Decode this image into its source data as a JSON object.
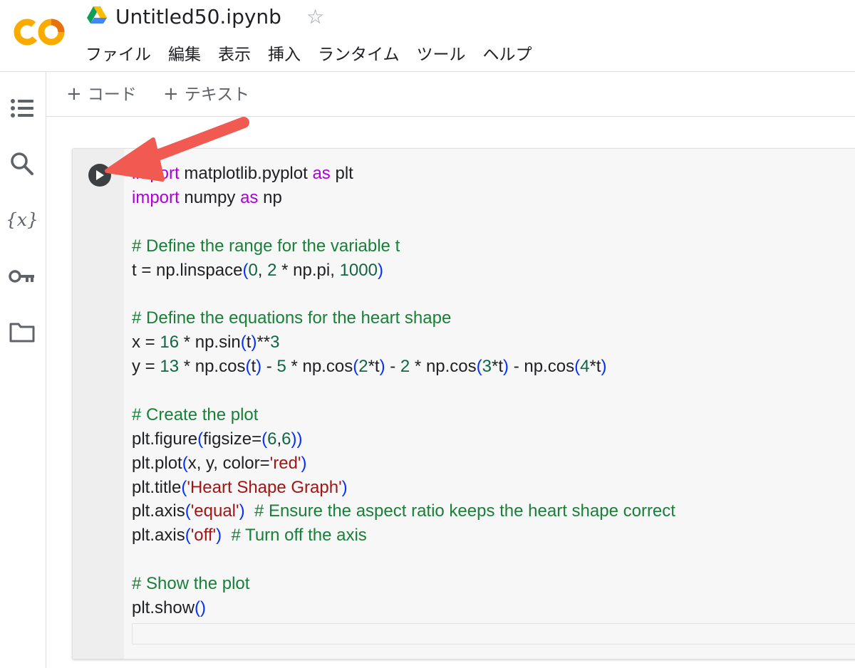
{
  "app": {
    "notebook_title": "Untitled50.ipynb",
    "menu": [
      "ファイル",
      "編集",
      "表示",
      "挿入",
      "ランタイム",
      "ツール",
      "ヘルプ"
    ]
  },
  "sidebar": {
    "icons": [
      "table-of-contents-icon",
      "search-icon",
      "variables-icon",
      "secrets-key-icon",
      "files-folder-icon"
    ],
    "variables_glyph": "{x}"
  },
  "toolbar": {
    "add_code_label": "コード",
    "add_text_label": "テキスト",
    "plus": "+"
  },
  "cell": {
    "code_lines": [
      [
        {
          "t": "import",
          "c": "kw"
        },
        {
          "t": " matplotlib.pyplot "
        },
        {
          "t": "as",
          "c": "kw"
        },
        {
          "t": " plt"
        }
      ],
      [
        {
          "t": "import",
          "c": "kw"
        },
        {
          "t": " numpy "
        },
        {
          "t": "as",
          "c": "kw"
        },
        {
          "t": " np"
        }
      ],
      [],
      [
        {
          "t": "# Define the range for the variable t",
          "c": "cm"
        }
      ],
      [
        {
          "t": "t = np.linspace"
        },
        {
          "t": "(",
          "c": "br"
        },
        {
          "t": "0",
          "c": "num"
        },
        {
          "t": ", "
        },
        {
          "t": "2",
          "c": "num"
        },
        {
          "t": " * np.pi, "
        },
        {
          "t": "1000",
          "c": "num"
        },
        {
          "t": ")",
          "c": "br"
        }
      ],
      [],
      [
        {
          "t": "# Define the equations for the heart shape",
          "c": "cm"
        }
      ],
      [
        {
          "t": "x = "
        },
        {
          "t": "16",
          "c": "num"
        },
        {
          "t": " * np.sin"
        },
        {
          "t": "(",
          "c": "br"
        },
        {
          "t": "t"
        },
        {
          "t": ")",
          "c": "br"
        },
        {
          "t": "**"
        },
        {
          "t": "3",
          "c": "num"
        }
      ],
      [
        {
          "t": "y = "
        },
        {
          "t": "13",
          "c": "num"
        },
        {
          "t": " * np.cos"
        },
        {
          "t": "(",
          "c": "br"
        },
        {
          "t": "t"
        },
        {
          "t": ")",
          "c": "br"
        },
        {
          "t": " - "
        },
        {
          "t": "5",
          "c": "num"
        },
        {
          "t": " * np.cos"
        },
        {
          "t": "(",
          "c": "br"
        },
        {
          "t": "2",
          "c": "num"
        },
        {
          "t": "*t"
        },
        {
          "t": ")",
          "c": "br"
        },
        {
          "t": " - "
        },
        {
          "t": "2",
          "c": "num"
        },
        {
          "t": " * np.cos"
        },
        {
          "t": "(",
          "c": "br"
        },
        {
          "t": "3",
          "c": "num"
        },
        {
          "t": "*t"
        },
        {
          "t": ")",
          "c": "br"
        },
        {
          "t": " - np.cos"
        },
        {
          "t": "(",
          "c": "br"
        },
        {
          "t": "4",
          "c": "num"
        },
        {
          "t": "*t"
        },
        {
          "t": ")",
          "c": "br"
        }
      ],
      [],
      [
        {
          "t": "# Create the plot",
          "c": "cm"
        }
      ],
      [
        {
          "t": "plt.figure"
        },
        {
          "t": "(",
          "c": "br"
        },
        {
          "t": "figsize="
        },
        {
          "t": "(",
          "c": "br"
        },
        {
          "t": "6",
          "c": "num"
        },
        {
          "t": ","
        },
        {
          "t": "6",
          "c": "num"
        },
        {
          "t": "))",
          "c": "br"
        }
      ],
      [
        {
          "t": "plt.plot"
        },
        {
          "t": "(",
          "c": "br"
        },
        {
          "t": "x, y, color="
        },
        {
          "t": "'red'",
          "c": "str"
        },
        {
          "t": ")",
          "c": "br"
        }
      ],
      [
        {
          "t": "plt.title"
        },
        {
          "t": "(",
          "c": "br"
        },
        {
          "t": "'Heart Shape Graph'",
          "c": "str"
        },
        {
          "t": ")",
          "c": "br"
        }
      ],
      [
        {
          "t": "plt.axis"
        },
        {
          "t": "(",
          "c": "br"
        },
        {
          "t": "'equal'",
          "c": "str"
        },
        {
          "t": ")",
          "c": "br"
        },
        {
          "t": "  "
        },
        {
          "t": "# Ensure the aspect ratio keeps the heart shape correct",
          "c": "cm"
        }
      ],
      [
        {
          "t": "plt.axis"
        },
        {
          "t": "(",
          "c": "br"
        },
        {
          "t": "'off'",
          "c": "str"
        },
        {
          "t": ")",
          "c": "br"
        },
        {
          "t": "  "
        },
        {
          "t": "# Turn off the axis",
          "c": "cm"
        }
      ],
      [],
      [
        {
          "t": "# Show the plot",
          "c": "cm"
        }
      ],
      [
        {
          "t": "plt.show"
        },
        {
          "t": "()",
          "c": "br"
        }
      ]
    ]
  },
  "colors": {
    "logo_orange": "#F9AB00",
    "logo_dark_orange": "#E8710A",
    "annotation_arrow": "#F05A50",
    "keyword": "#AF00DB",
    "comment": "#188038",
    "number": "#116644",
    "string": "#A31515",
    "bracket": "#0431FA"
  }
}
